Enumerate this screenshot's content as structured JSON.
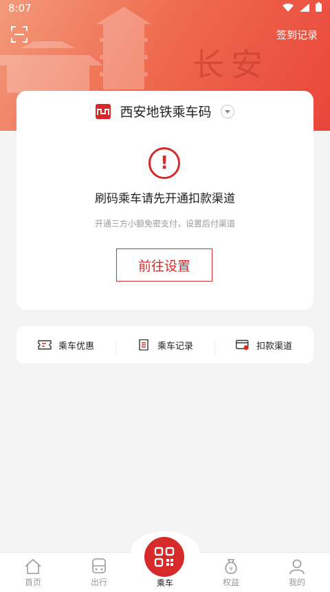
{
  "status_bar": {
    "time": "8:07"
  },
  "header": {
    "checkin_label": "签到记录",
    "calligraphy": "长安"
  },
  "card": {
    "line_name": "西安地铁乘车码",
    "message": "刷码乘车请先开通扣款渠道",
    "sub_message": "开通三方小额免密支付，设置后付渠道",
    "setup_button": "前往设置"
  },
  "quick_links": [
    {
      "label": "乘车优惠",
      "icon": "ticket-icon"
    },
    {
      "label": "乘车记录",
      "icon": "record-icon"
    },
    {
      "label": "扣款渠道",
      "icon": "card-icon"
    }
  ],
  "tabs": [
    {
      "label": "首页",
      "icon": "home-icon"
    },
    {
      "label": "出行",
      "icon": "train-icon"
    },
    {
      "label": "乘车",
      "icon": "qr-code-icon"
    },
    {
      "label": "权益",
      "icon": "moneybag-icon"
    },
    {
      "label": "我的",
      "icon": "person-icon"
    }
  ],
  "colors": {
    "brand_red": "#d62a2a",
    "header_gradient_start": "#f39a7a",
    "header_gradient_end": "#e9453a"
  }
}
